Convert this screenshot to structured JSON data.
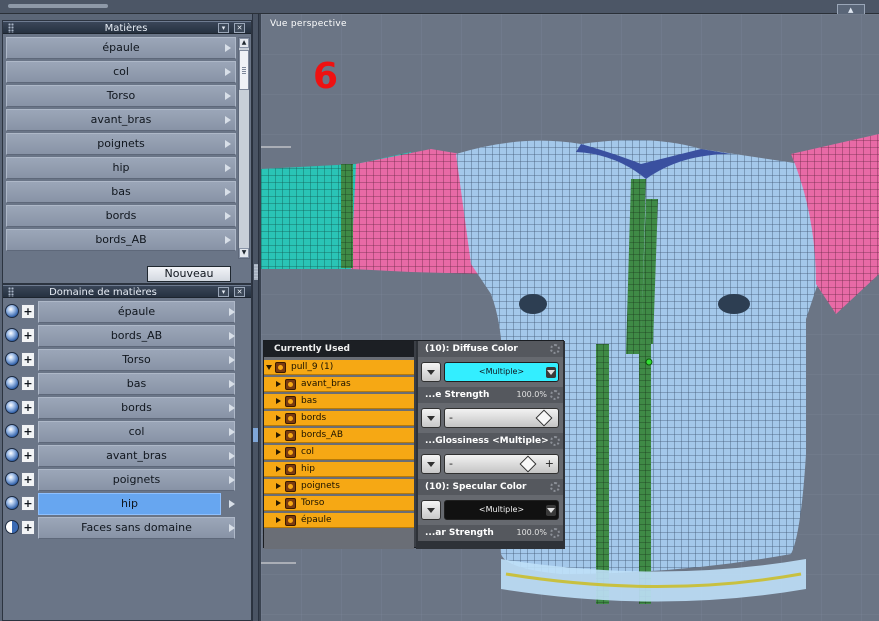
{
  "viewport": {
    "title": "Vue perspective",
    "big_number": "6"
  },
  "matieres_panel": {
    "title": "Matières",
    "items": [
      "épaule",
      "col",
      "Torso",
      "avant_bras",
      "poignets",
      "hip",
      "bas",
      "bords",
      "bords_AB"
    ],
    "new_button": "Nouveau"
  },
  "domaine_panel": {
    "title": "Domaine de matières",
    "items": [
      "épaule",
      "bords_AB",
      "Torso",
      "bas",
      "bords",
      "col",
      "avant_bras",
      "poignets",
      "hip",
      "Faces sans domaine"
    ],
    "selected": "hip"
  },
  "currently_used": {
    "title": "Currently Used",
    "root": "pull_9 (1)",
    "items": [
      "avant_bras",
      "bas",
      "bords",
      "bords_AB",
      "col",
      "hip",
      "poignets",
      "Torso",
      "épaule"
    ]
  },
  "properties": {
    "diffuse": {
      "label": "(10): Diffuse Color",
      "value": "<Multiple>",
      "color": "#33eeff"
    },
    "strength": {
      "label": "...e Strength",
      "pct": "100.0%",
      "level": 1.0
    },
    "glossiness": {
      "label": "...Glossiness  <Multiple>",
      "level": 0.8
    },
    "specular": {
      "label": "(10): Specular Color",
      "value": "<Multiple>",
      "color": "#111111"
    },
    "ar_strength": {
      "label": "...ar Strength",
      "pct": "100.0%"
    }
  },
  "colors": {
    "accent_blue": "#67a6f0",
    "used_orange": "#f6a814",
    "mesh_pink": "#e86aa6",
    "mesh_teal": "#2ac4b6",
    "mesh_blue": "#9cc6ec",
    "mesh_green": "#3a8a3a"
  }
}
